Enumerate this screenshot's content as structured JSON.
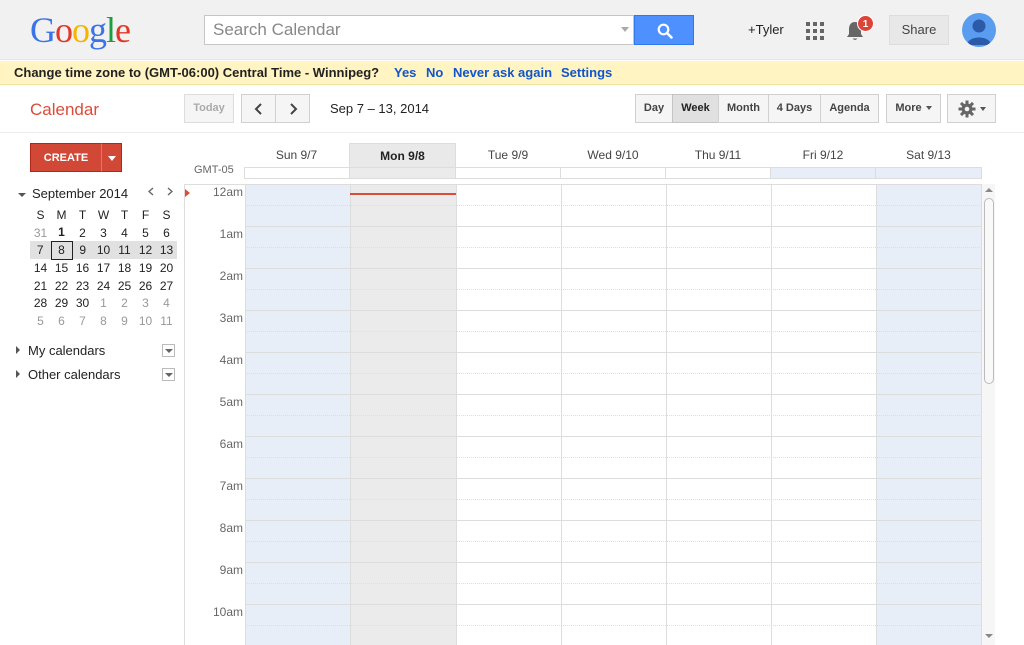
{
  "logo": {
    "letters": [
      "G",
      "o",
      "o",
      "g",
      "l",
      "e"
    ],
    "colors": [
      "#3b73e8",
      "#e0392b",
      "#f4b400",
      "#3b73e8",
      "#1a9e3f",
      "#e0392b"
    ]
  },
  "header": {
    "search_placeholder": "Search Calendar",
    "user_name": "+Tyler",
    "notification_count": "1",
    "share_label": "Share"
  },
  "banner": {
    "message": "Change time zone to (GMT-06:00) Central Time - Winnipeg?",
    "yes": "Yes",
    "no": "No",
    "never": "Never ask again",
    "settings": "Settings"
  },
  "toolbar": {
    "app_title": "Calendar",
    "today": "Today",
    "date_range": "Sep 7 – 13, 2014",
    "views": {
      "day": "Day",
      "week": "Week",
      "month": "Month",
      "four_days": "4 Days",
      "agenda": "Agenda"
    },
    "more": "More"
  },
  "sidebar": {
    "create_label": "CREATE",
    "mini_cal": {
      "month_label": "September 2014",
      "weekdays": [
        "S",
        "M",
        "T",
        "W",
        "T",
        "F",
        "S"
      ],
      "weeks": [
        [
          "31",
          "1",
          "2",
          "3",
          "4",
          "5",
          "6"
        ],
        [
          "7",
          "8",
          "9",
          "10",
          "11",
          "12",
          "13"
        ],
        [
          "14",
          "15",
          "16",
          "17",
          "18",
          "19",
          "20"
        ],
        [
          "21",
          "22",
          "23",
          "24",
          "25",
          "26",
          "27"
        ],
        [
          "28",
          "29",
          "30",
          "1",
          "2",
          "3",
          "4"
        ],
        [
          "5",
          "6",
          "7",
          "8",
          "9",
          "10",
          "11"
        ]
      ]
    },
    "my_calendars": "My calendars",
    "other_calendars": "Other calendars"
  },
  "week": {
    "gmt_label": "GMT-05",
    "days": [
      "Sun 9/7",
      "Mon 9/8",
      "Tue 9/9",
      "Wed 9/10",
      "Thu 9/11",
      "Fri 9/12",
      "Sat 9/13"
    ],
    "today_index": 1,
    "hours": [
      "12am",
      "1am",
      "2am",
      "3am",
      "4am",
      "5am",
      "6am",
      "7am",
      "8am",
      "9am",
      "10am"
    ]
  },
  "colors": {
    "accent_red": "#dd4b39",
    "search_blue": "#4d90fe",
    "weekend_blue": "#e8eef7",
    "link_blue": "#1155cc"
  }
}
